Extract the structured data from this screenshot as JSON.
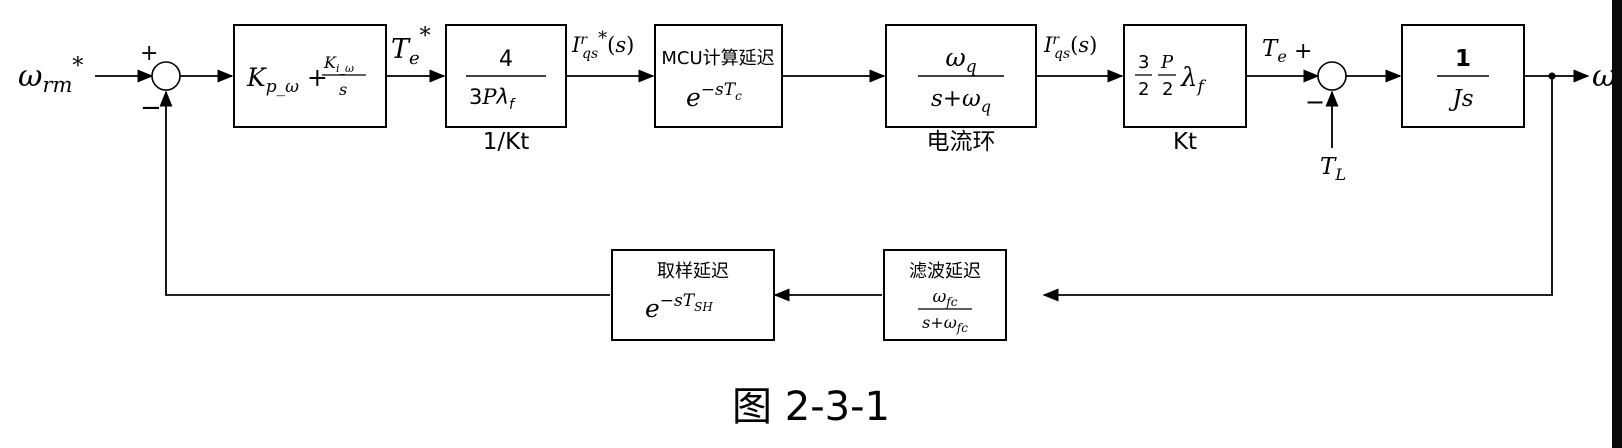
{
  "input_label": "ω_rm*",
  "sum1": {
    "plus": "+",
    "minus": "−"
  },
  "pi_block": {
    "kp": "K_p_ω +",
    "ki": "K_i_ω",
    "ki_den": "s"
  },
  "te_star_label": "T_e*",
  "inv_kt_block": {
    "num": "4",
    "den": "3Pλ_f",
    "caption": "1/Kt"
  },
  "iqs_star_label": "I^r_qs*(s)",
  "mcu_block": {
    "title": "MCU计算延迟",
    "expr": "e^-sT_c"
  },
  "current_loop_block": {
    "num": "ω_q",
    "den": "s+ω_q",
    "caption": "电流环"
  },
  "iqs_label": "I^r_qs(s)",
  "kt_block": {
    "expr": "3/2 P/2 λ_f",
    "caption": "Kt"
  },
  "te_label": "T_e",
  "sum2": {
    "plus": "+",
    "minus": "−"
  },
  "tl_label": "T_L",
  "plant_block": {
    "num": "1",
    "den": "Js"
  },
  "output_label": "ω",
  "filter_block": {
    "title": "滤波延迟",
    "num": "ω_fc",
    "den": "s+ω_fc"
  },
  "sample_block": {
    "title": "取样延迟",
    "expr": "e^-sT_SH"
  },
  "figure_caption": "图 2-3-1"
}
